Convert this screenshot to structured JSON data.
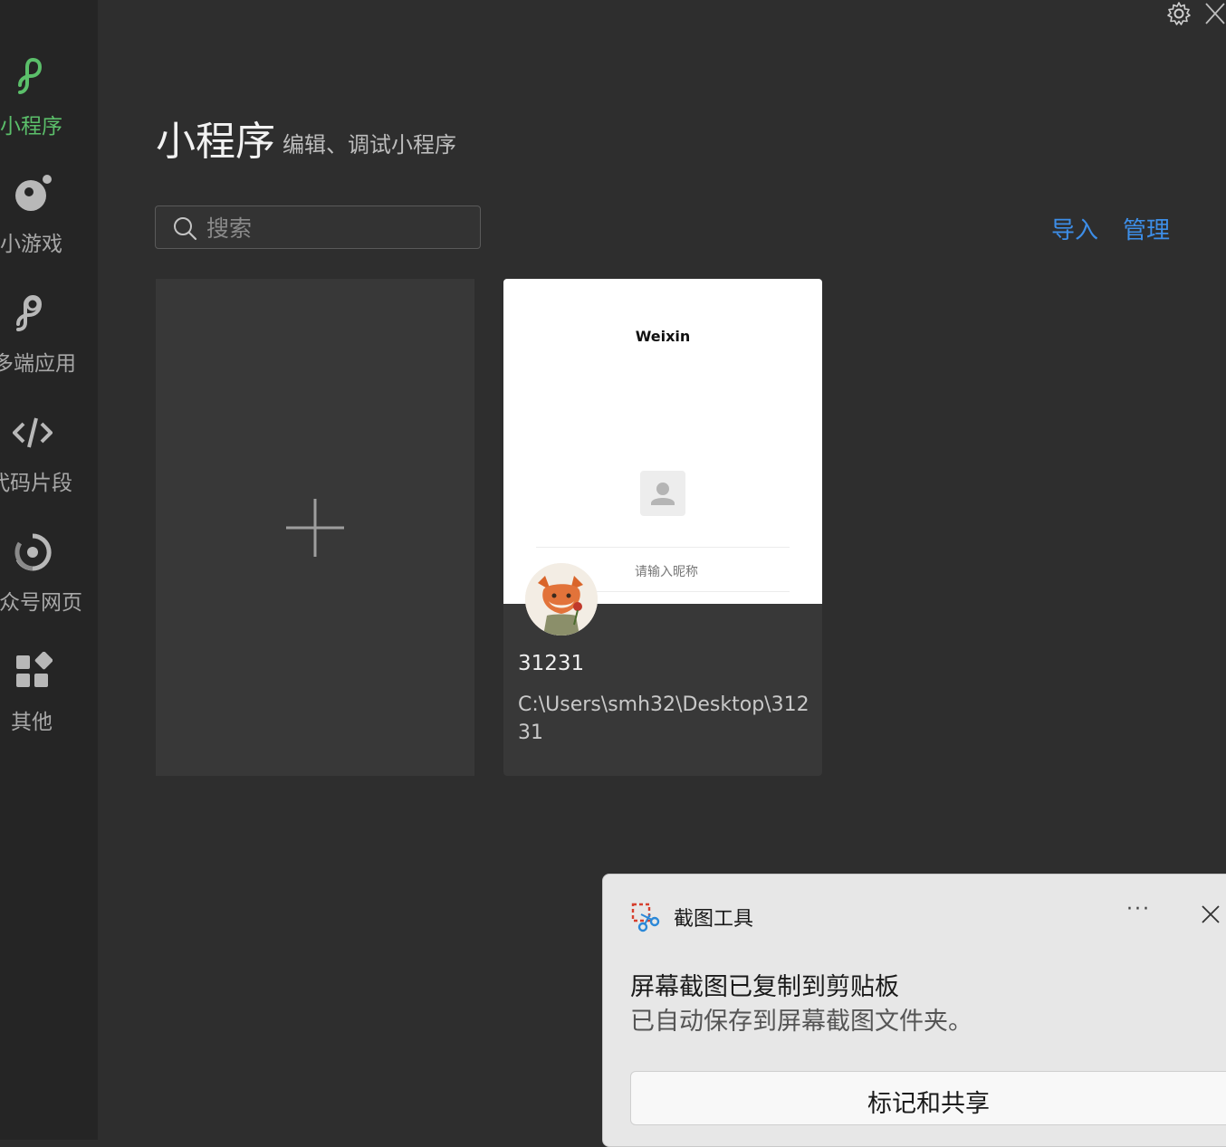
{
  "sidebar": {
    "items": [
      {
        "label": "小程序",
        "icon": "mini-program-icon",
        "active": true
      },
      {
        "label": "小游戏",
        "icon": "mini-game-icon"
      },
      {
        "label": "多端应用",
        "icon": "multi-platform-icon"
      },
      {
        "label": "代码片段",
        "icon": "code-icon"
      },
      {
        "label": "公众号网页",
        "icon": "official-account-icon"
      },
      {
        "label": "其他",
        "icon": "apps-grid-icon"
      }
    ],
    "active_color": "#5bbf6a"
  },
  "header": {
    "title": "小程序",
    "subtitle": "编辑、调试小程序"
  },
  "search": {
    "placeholder": "搜索"
  },
  "actions": {
    "import_label": "导入",
    "manage_label": "管理",
    "link_color": "#3d8ee8"
  },
  "projects": [
    {
      "preview_title": "Weixin",
      "preview_nickname_placeholder": "请输入昵称",
      "name": "31231",
      "path": "C:\\Users\\smh32\\Desktop\\31231"
    }
  ],
  "toast": {
    "app_name": "截图工具",
    "more": "···",
    "title": "屏幕截图已复制到剪贴板",
    "body": "已自动保存到屏幕截图文件夹。",
    "button_label": "标记和共享"
  }
}
